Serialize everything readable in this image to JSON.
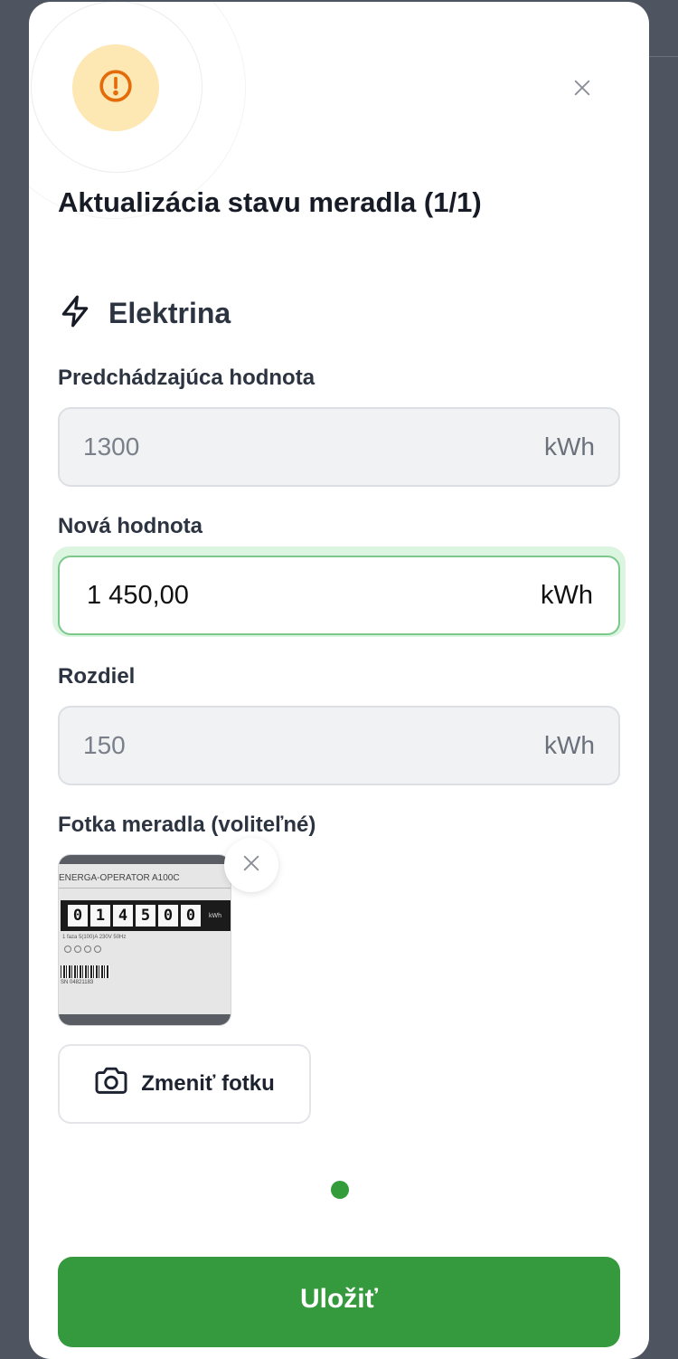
{
  "modal": {
    "title": "Aktualizácia stavu meradla (1/1)",
    "close_icon": "close-icon",
    "alert_icon": "alert-circle-icon"
  },
  "section": {
    "icon": "lightning-bolt-icon",
    "label": "Elektrina"
  },
  "previous": {
    "label": "Predchádzajúca hodnota",
    "value": "1300",
    "unit": "kWh"
  },
  "new_value": {
    "label": "Nová hodnota",
    "value": "1 450,00",
    "unit": "kWh"
  },
  "difference": {
    "label": "Rozdiel",
    "value": "150",
    "unit": "kWh"
  },
  "photo": {
    "label": "Fotka meradla (voliteľné)",
    "meter_brand": "ENERGA-OPERATOR  A100C",
    "meter_digits": [
      "0",
      "1",
      "4",
      "5",
      "0",
      "0"
    ],
    "meter_unit": "kWh",
    "meter_specs": "1 faza     5(100)A     230V     50Hz",
    "meter_serial": "SN 04821183",
    "remove_icon": "close-icon",
    "change_label": "Zmeniť fotku",
    "change_icon": "camera-icon"
  },
  "pagination": {
    "current": 1,
    "total": 1
  },
  "actions": {
    "save_label": "Uložiť"
  },
  "colors": {
    "accent_green": "#359a3d",
    "alert_bg": "#fde7b3",
    "alert_icon": "#e36b0a",
    "focus_ring": "#dcf5e1"
  }
}
